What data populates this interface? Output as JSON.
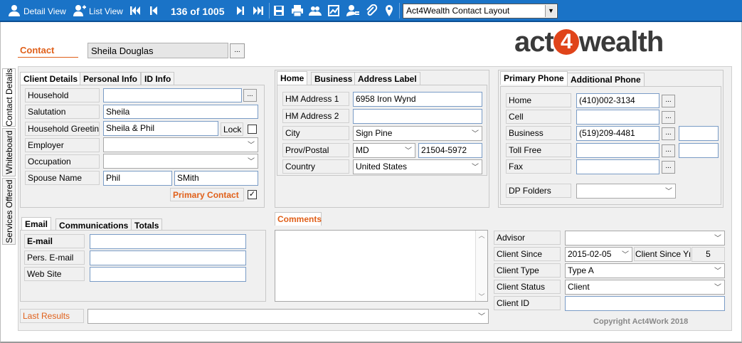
{
  "toolbar": {
    "detail_view": "Detail View",
    "list_view": "List View",
    "record_counter": "136 of 1005",
    "layout_selected": "Act4Wealth Contact Layout",
    "icons": [
      "user-icon",
      "user-add-icon",
      "first-record-icon",
      "prev-record-icon",
      "next-record-icon",
      "last-record-icon",
      "save-icon",
      "print-icon",
      "contacts-icon",
      "chart-icon",
      "user-profile-icon",
      "attach-icon",
      "map-pin-icon"
    ]
  },
  "side_tabs": [
    "Contact Details",
    "Whiteboard",
    "Services Offered"
  ],
  "contact": {
    "label": "Contact",
    "name": "Sheila Douglas",
    "dots": "..."
  },
  "logo": {
    "part1": "act",
    "part2": "4",
    "part3": "wealth"
  },
  "client_tabs": [
    "Client Details",
    "Personal Info",
    "ID Info"
  ],
  "client": {
    "household_label": "Household",
    "household_value": "",
    "salutation_label": "Salutation",
    "salutation_value": "Sheila",
    "greeting_label": "Household Greeting",
    "greeting_value": "Sheila & Phil",
    "lock_label": "Lock",
    "employer_label": "Employer",
    "employer_value": "",
    "occupation_label": "Occupation",
    "occupation_value": "",
    "spouse_label": "Spouse Name",
    "spouse_first": "Phil",
    "spouse_last": "SMith",
    "primary_contact_label": "Primary Contact",
    "primary_contact_check": "✓"
  },
  "address_tabs": [
    "Home",
    "Business",
    "Address Label"
  ],
  "address": {
    "addr1_label": "HM Address 1",
    "addr1_value": "6958 Iron Wynd",
    "addr2_label": "HM Address 2",
    "addr2_value": "",
    "city_label": "City",
    "city_value": "Sign Pine",
    "prov_label": "Prov/Postal",
    "prov_value": "MD",
    "postal_value": "21504-5972",
    "country_label": "Country",
    "country_value": "United States"
  },
  "phone_tabs": [
    "Primary Phone",
    "Additional Phone"
  ],
  "phone": {
    "home_label": "Home",
    "home_value": "(410)002-3134",
    "cell_label": "Cell",
    "cell_value": "",
    "business_label": "Business",
    "business_value": "(519)209-4481",
    "tollfree_label": "Toll Free",
    "tollfree_value": "",
    "fax_label": "Fax",
    "fax_value": "",
    "dp_label": "DP Folders",
    "dp_value": ""
  },
  "email_tabs": [
    "Email",
    "Communications",
    "Totals"
  ],
  "email": {
    "email_label": "E-mail",
    "email_value": "",
    "pers_label": "Pers. E-mail",
    "pers_value": "",
    "web_label": "Web Site",
    "web_value": ""
  },
  "comments": {
    "label": "Comments",
    "value": ""
  },
  "advisor": {
    "advisor_label": "Advisor",
    "advisor_value": "",
    "since_label": "Client Since",
    "since_value": "2015-02-05",
    "since_yrs_label": "Client Since Yrs",
    "since_yrs_value": "5",
    "type_label": "Client Type",
    "type_value": "Type A",
    "status_label": "Client Status",
    "status_value": "Client",
    "id_label": "Client ID",
    "id_value": ""
  },
  "last_results": {
    "label": "Last Results",
    "value": ""
  },
  "copyright": "Copyright Act4Work 2018",
  "colors": {
    "toolbar": "#1a73c7",
    "accent": "#e0601a",
    "logo_badge": "#e0441a"
  }
}
